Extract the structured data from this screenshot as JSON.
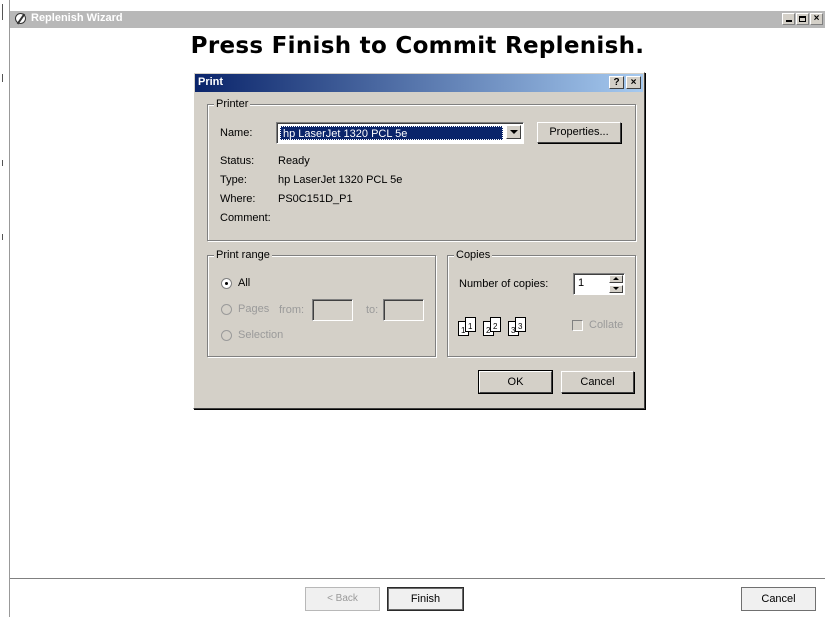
{
  "window": {
    "title": "Replenish Wizard",
    "icon": "wizard-icon",
    "controls": {
      "minimize": "_",
      "maximize": "□",
      "close": "×"
    }
  },
  "headline": "Press Finish to Commit Replenish.",
  "dialog": {
    "title": "Print",
    "help_btn": "?",
    "close_btn": "×",
    "printer": {
      "group_label": "Printer",
      "name_label": "Name:",
      "name_value": "hp LaserJet 1320 PCL 5e",
      "properties_label": "Properties...",
      "status_label": "Status:",
      "status_value": "Ready",
      "type_label": "Type:",
      "type_value": "hp LaserJet 1320 PCL 5e",
      "where_label": "Where:",
      "where_value": "PS0C151D_P1",
      "comment_label": "Comment:"
    },
    "print_range": {
      "group_label": "Print range",
      "all_label": "All",
      "pages_label": "Pages",
      "from_label": "from:",
      "to_label": "to:",
      "selection_label": "Selection",
      "selected": "All"
    },
    "copies": {
      "group_label": "Copies",
      "number_label": "Number of copies:",
      "number_value": "1",
      "collate_label": "Collate",
      "collate_checked": false,
      "page_numbers": [
        "1",
        "1",
        "2",
        "2",
        "3",
        "3"
      ]
    },
    "ok_label": "OK",
    "cancel_label": "Cancel"
  },
  "wizard_nav": {
    "back_label": "< Back",
    "finish_label": "Finish",
    "cancel_label": "Cancel"
  },
  "colors": {
    "dialog_bg": "#d4d0c8",
    "title_active": "#0a246a",
    "selection": "#0a246a",
    "outer_titlebar": "#b8b8b8"
  }
}
